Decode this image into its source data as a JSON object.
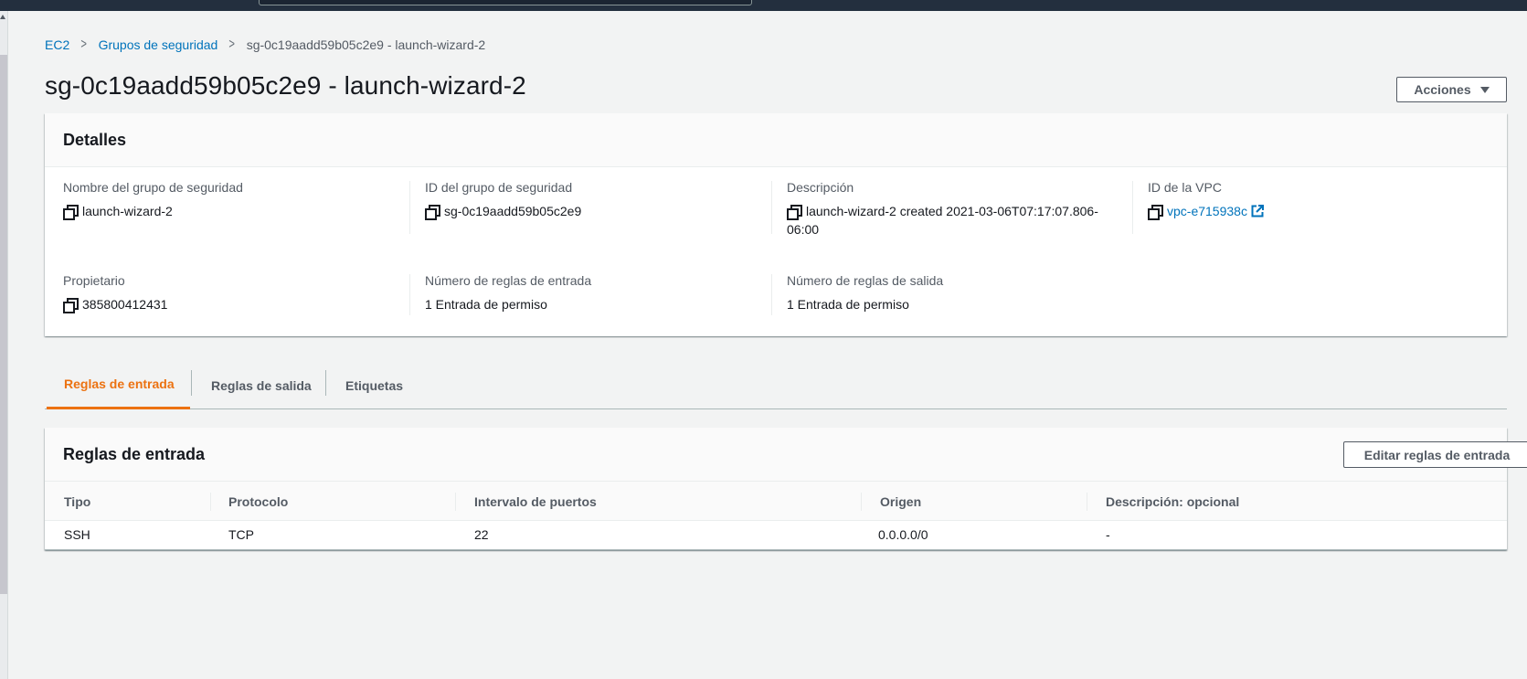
{
  "breadcrumb": {
    "items": [
      {
        "label": "EC2"
      },
      {
        "label": "Grupos de seguridad"
      }
    ],
    "current": "sg-0c19aadd59b05c2e9 - launch-wizard-2"
  },
  "page": {
    "title": "sg-0c19aadd59b05c2e9 - launch-wizard-2",
    "actions_label": "Acciones"
  },
  "details": {
    "header": "Detalles",
    "fields": [
      {
        "label": "Nombre del grupo de seguridad",
        "value": "launch-wizard-2"
      },
      {
        "label": "ID del grupo de seguridad",
        "value": "sg-0c19aadd59b05c2e9"
      },
      {
        "label": "Descripción",
        "value_line1": "launch-wizard-2 created 2021-03-06T07:17:07.806-",
        "value_line2": "06:00"
      },
      {
        "label": "ID de la VPC",
        "value": "vpc-e715938c"
      },
      {
        "label": "Propietario",
        "value": "385800412431"
      },
      {
        "label": "Número de reglas de entrada",
        "value": "1 Entrada de permiso"
      },
      {
        "label": "Número de reglas de salida",
        "value": "1 Entrada de permiso"
      }
    ]
  },
  "tabs": [
    {
      "label": "Reglas de entrada",
      "active": true
    },
    {
      "label": "Reglas de salida",
      "active": false
    },
    {
      "label": "Etiquetas",
      "active": false
    }
  ],
  "inbound_rules": {
    "header": "Reglas de entrada",
    "edit_label": "Editar reglas de entrada",
    "columns": [
      "Tipo",
      "Protocolo",
      "Intervalo de puertos",
      "Origen",
      "Descripción: opcional"
    ],
    "rows": [
      [
        "SSH",
        "TCP",
        "22",
        "0.0.0.0/0",
        "-"
      ]
    ]
  },
  "colors": {
    "accent": "#ec7211",
    "link": "#0073bb",
    "topbar": "#232f3e"
  }
}
